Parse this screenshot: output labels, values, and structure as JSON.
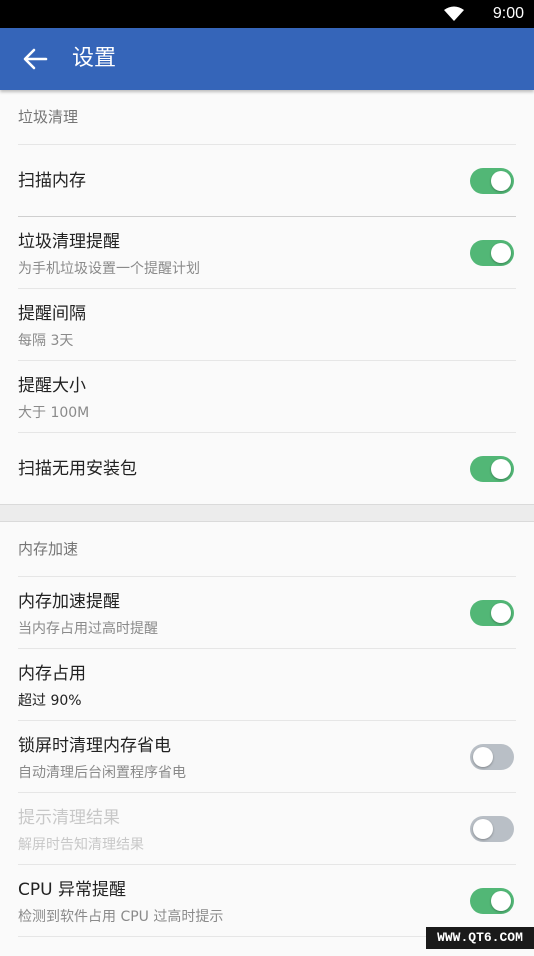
{
  "status_bar": {
    "time": "9:00",
    "icons": [
      "wifi-icon"
    ]
  },
  "app_bar": {
    "title": "设置",
    "back_icon": "arrow-left-icon"
  },
  "sections": [
    {
      "title": "垃圾清理",
      "items": [
        {
          "label": "扫描内存",
          "toggle": "on"
        },
        {
          "label": "垃圾清理提醒",
          "sub": "为手机垃圾设置一个提醒计划",
          "toggle": "on"
        },
        {
          "label": "提醒间隔",
          "sub": "每隔 3天"
        },
        {
          "label": "提醒大小",
          "sub": "大于 100M"
        },
        {
          "label": "扫描无用安装包",
          "toggle": "on"
        }
      ]
    },
    {
      "title": "内存加速",
      "items": [
        {
          "label": "内存加速提醒",
          "sub": "当内存占用过高时提醒",
          "toggle": "on"
        },
        {
          "label": "内存占用",
          "sub": "超过 90%"
        },
        {
          "label": "锁屏时清理内存省电",
          "sub": "自动清理后台闲置程序省电",
          "toggle": "off"
        },
        {
          "label": "提示清理结果",
          "sub": "解屏时告知清理结果",
          "toggle": "off",
          "disabled": true
        },
        {
          "label": "CPU 异常提醒",
          "sub": "检测到软件占用 CPU 过高时提示",
          "toggle": "on"
        }
      ]
    }
  ],
  "watermark": "WWW.QT6.COM",
  "colors": {
    "app_bar": "#3565b9",
    "toggle_on": "#52b776",
    "toggle_off": "#b9bfc6"
  }
}
